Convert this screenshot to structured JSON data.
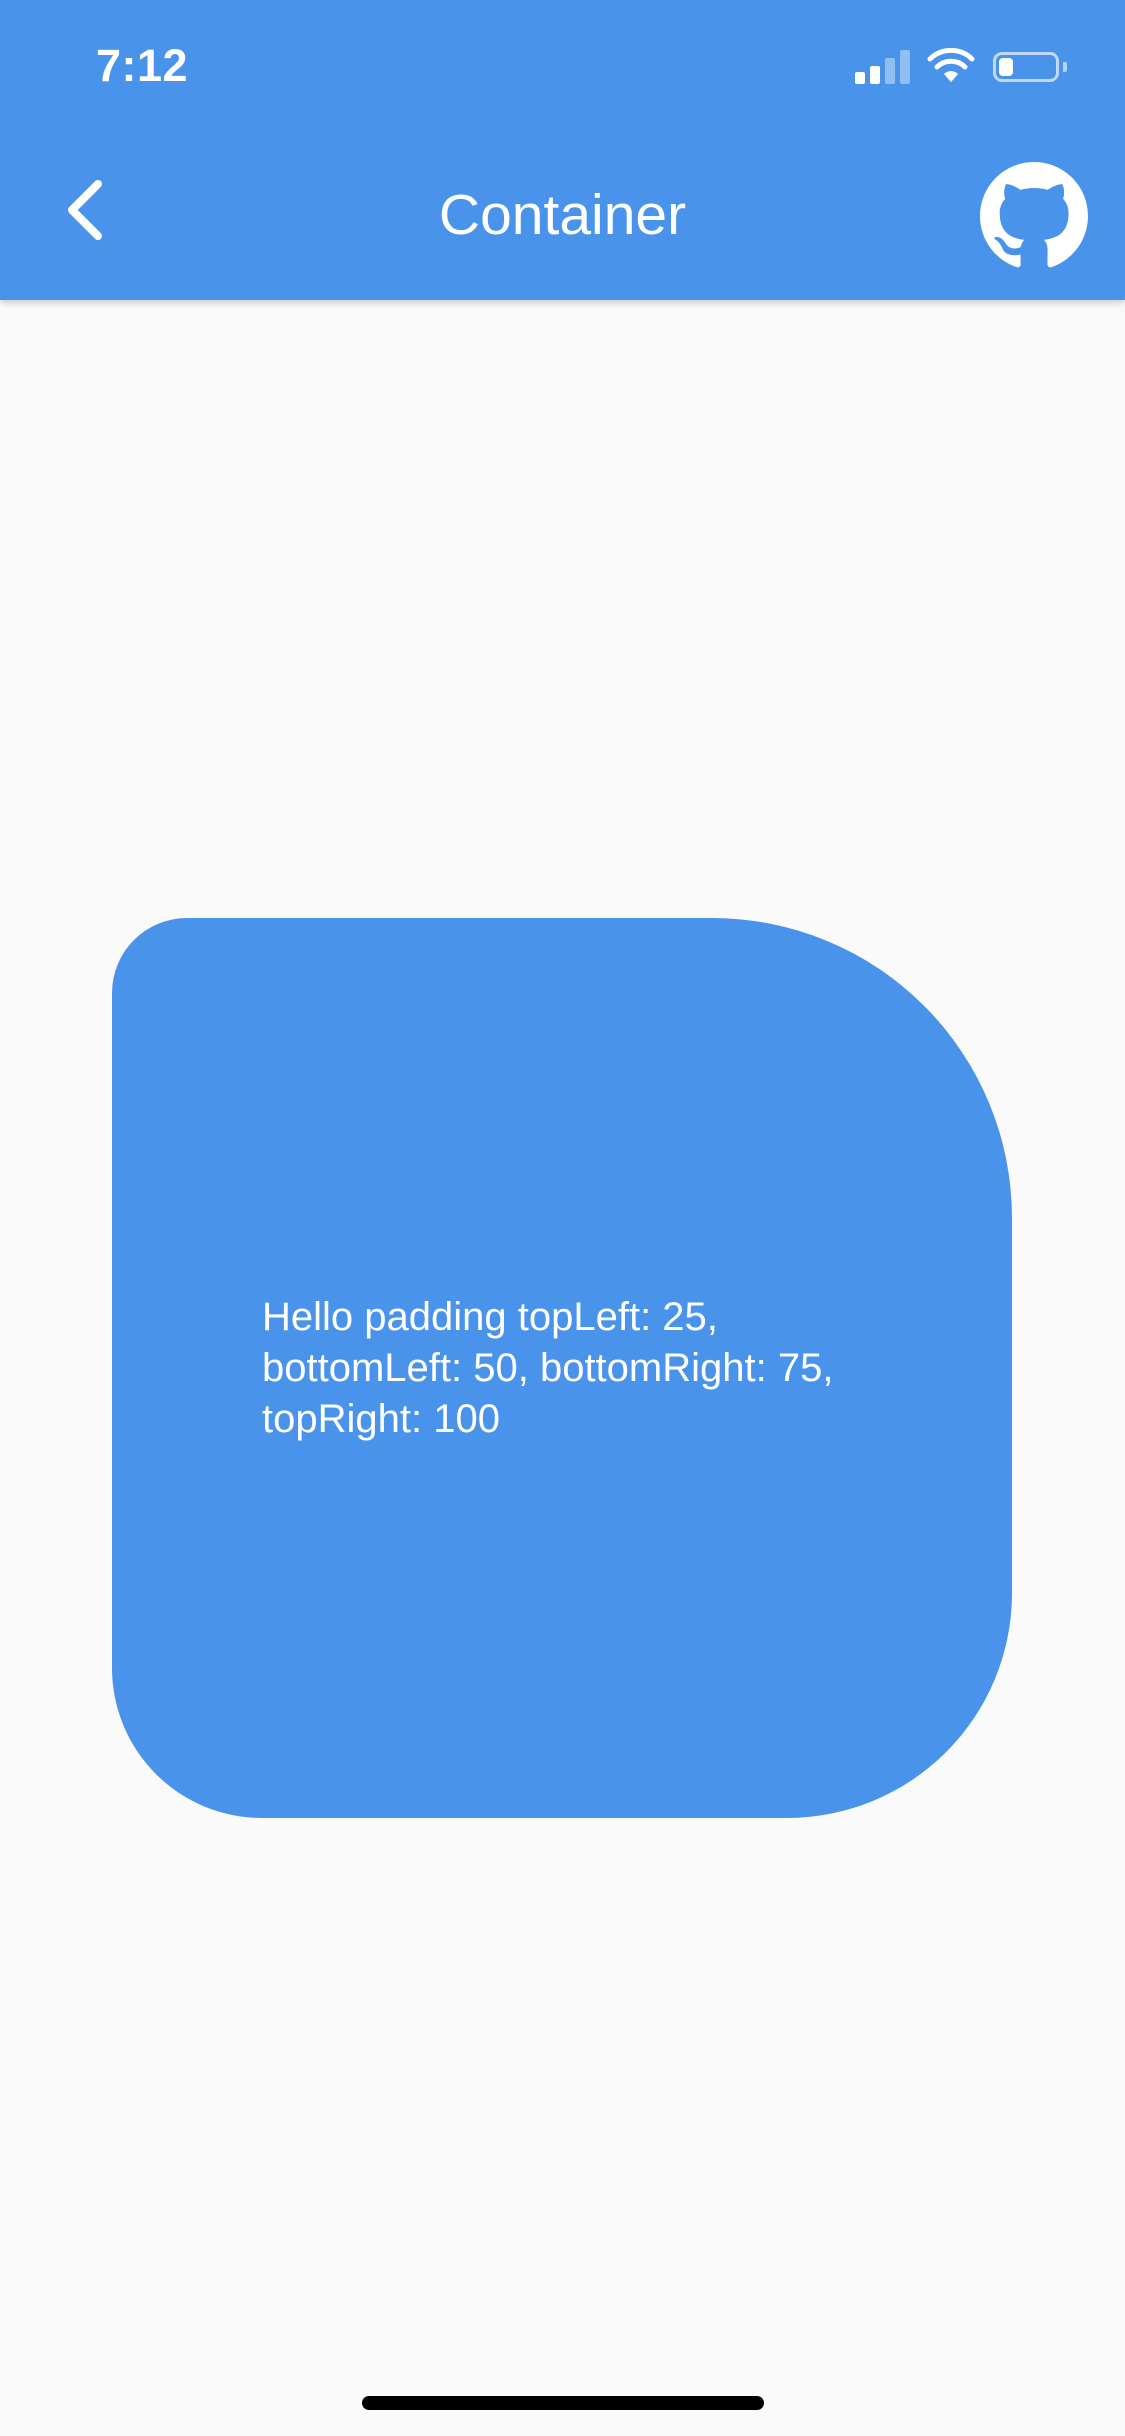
{
  "status_bar": {
    "time": "7:12",
    "battery_level": 0.25,
    "icons": [
      "cellular-signal-icon",
      "wifi-icon",
      "battery-icon"
    ]
  },
  "app_bar": {
    "title": "Container",
    "back_icon": "chevron-left-icon",
    "action_icon": "github-icon",
    "background_color": "#4a93eb"
  },
  "main": {
    "container_text": "Hello padding topLeft: 25, bottomLeft: 50, bottomRight: 75, topRight: 100",
    "container_color": "#4a93eb",
    "text_color": "#ffffff"
  }
}
